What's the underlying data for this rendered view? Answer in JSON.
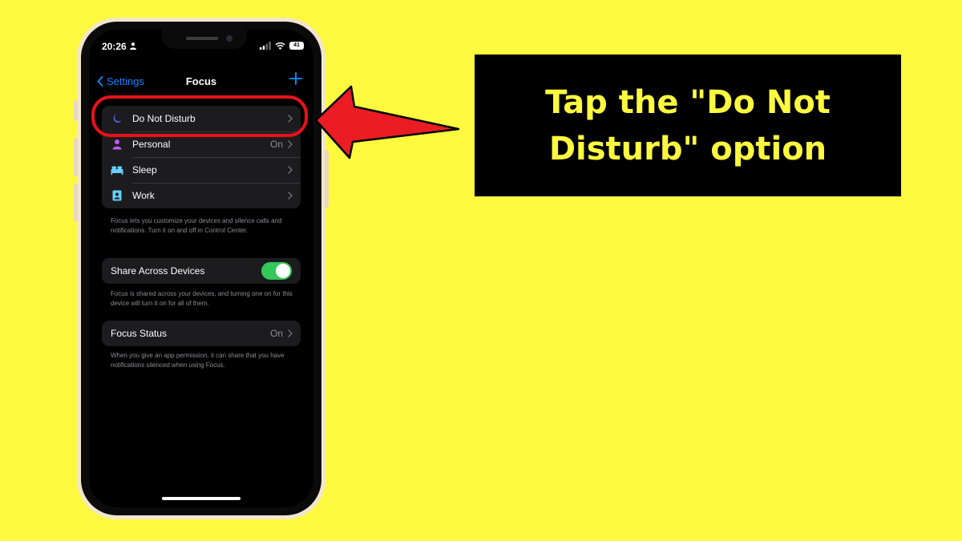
{
  "status_bar": {
    "time": "20:26",
    "battery": "41"
  },
  "nav": {
    "back_label": "Settings",
    "title": "Focus"
  },
  "focus_modes": [
    {
      "label": "Do Not Disturb",
      "value": "",
      "icon": "moon-icon",
      "color": "#5e5ce6"
    },
    {
      "label": "Personal",
      "value": "On",
      "icon": "person-icon",
      "color": "#bf5af2"
    },
    {
      "label": "Sleep",
      "value": "",
      "icon": "bed-icon",
      "color": "#64d2ff"
    },
    {
      "label": "Work",
      "value": "",
      "icon": "id-badge-icon",
      "color": "#64d2ff"
    }
  ],
  "focus_footnote": "Focus lets you customize your devices and silence calls and notifications. Turn it on and off in Control Center.",
  "share": {
    "label": "Share Across Devices",
    "enabled": true
  },
  "share_footnote": "Focus is shared across your devices, and turning one on for this device will turn it on for all of them.",
  "focus_status": {
    "label": "Focus Status",
    "value": "On"
  },
  "status_footnote": "When you give an app permission, it can share that you have notifications silenced when using Focus.",
  "caption": "Tap the \"Do Not Disturb\" option",
  "colors": {
    "background": "#fdf93e",
    "accent": "#0a84ff",
    "highlight": "#e8121a",
    "toggle_on": "#34c759"
  }
}
